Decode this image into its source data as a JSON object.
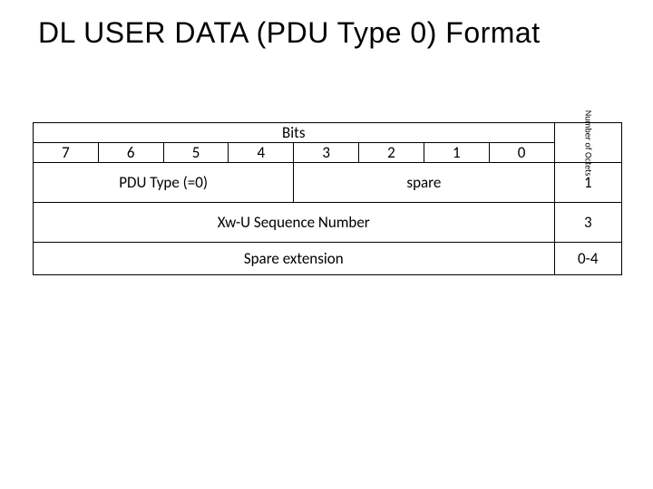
{
  "title": "DL USER DATA (PDU Type 0) Format",
  "table": {
    "bits_label": "Bits",
    "bit_numbers": [
      "7",
      "6",
      "5",
      "4",
      "3",
      "2",
      "1",
      "0"
    ],
    "octets_header": "Number of Octets",
    "rows": [
      {
        "cells": [
          {
            "text": "PDU Type (=0)",
            "span": 4
          },
          {
            "text": "spare",
            "span": 4
          }
        ],
        "octets": "1"
      },
      {
        "cells": [
          {
            "text": "Xw-U Sequence Number",
            "span": 8
          }
        ],
        "octets": "3"
      },
      {
        "cells": [
          {
            "text": "Spare extension",
            "span": 8
          }
        ],
        "octets": "0-4"
      }
    ]
  }
}
